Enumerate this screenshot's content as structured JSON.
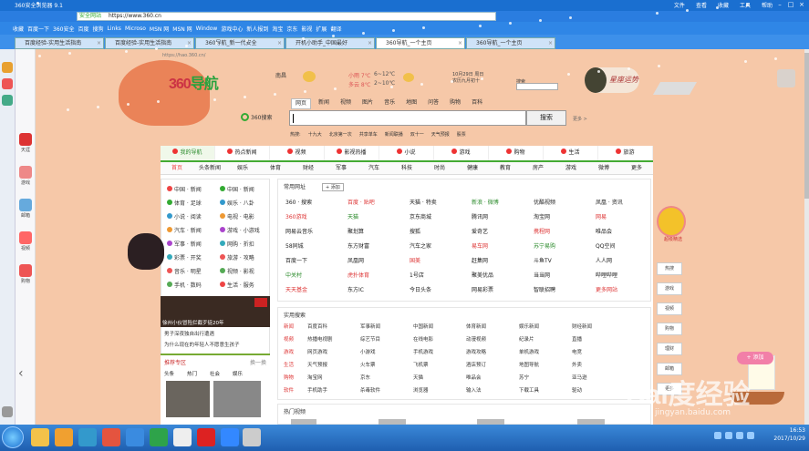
{
  "window": {
    "title": "360安全浏览器 9.1",
    "right_items": [
      "文件",
      "查看",
      "收藏",
      "工具",
      "帮助"
    ],
    "winbtns": [
      "–",
      "□",
      "×"
    ]
  },
  "address": {
    "security": "安全网站",
    "url": "https://www.360.cn"
  },
  "bookmarks": [
    "收藏",
    "百度一下",
    "360安全",
    "百度",
    "搜狗",
    "Links",
    "Microso",
    "MSN 网",
    "MSN 网",
    "Window",
    "游戏中心",
    "新人报到",
    "淘宝",
    "京东",
    "影视",
    "扩展",
    "翻译"
  ],
  "tabs": [
    {
      "label": "百度经验-实用生活指南",
      "active": false
    },
    {
      "label": "百度经验-实用生活指南",
      "active": false
    },
    {
      "label": "360导航_新一代安全",
      "active": false
    },
    {
      "label": "开机小助手_中国最好",
      "active": false
    },
    {
      "label": "360导航_一个主页",
      "active": true
    },
    {
      "label": "360导航_一个主页",
      "active": false
    }
  ],
  "side_labels": [
    "天涯",
    "游戏",
    "邮箱",
    "视频",
    "购物"
  ],
  "page": {
    "url_hint": "https://hao.360.cn/",
    "logo_prefix": "360",
    "logo_text": "导航",
    "weather": {
      "city": "南昌",
      "cond1": "小雨 7℃",
      "cond2": "多云 8℃",
      "day1": "今天",
      "day2": "明天",
      "temp1": "6~12℃",
      "temp2": "2~10℃"
    },
    "date": {
      "line1": "10月29日 周日",
      "line2": "农历九月初十"
    },
    "search_label": "搜索",
    "avatar_text": "星座运势",
    "search_tabs": [
      "网页",
      "新闻",
      "视频",
      "图片",
      "音乐",
      "地图",
      "问答",
      "购物",
      "百科"
    ],
    "search_engine": "360搜索",
    "search_button": "搜索",
    "search_extra": "更多 >",
    "hot_words": [
      "热搜:",
      "十九大",
      "北京第一次",
      "共享单车",
      "新闻联播",
      "双十一",
      "天气预报",
      "股票"
    ],
    "top_nav": [
      {
        "label": "我的导航",
        "active": true
      },
      {
        "label": "热点新闻",
        "active": false
      },
      {
        "label": "视频",
        "active": false
      },
      {
        "label": "影视热播",
        "active": false
      },
      {
        "label": "小说",
        "active": false
      },
      {
        "label": "游戏",
        "active": false
      },
      {
        "label": "购物",
        "active": false
      },
      {
        "label": "生活",
        "active": false
      },
      {
        "label": "旅游",
        "active": false
      }
    ],
    "sub_nav": [
      "首页",
      "头条新闻",
      "娱乐",
      "体育",
      "财经",
      "军事",
      "汽车",
      "科技",
      "时尚",
      "健康",
      "教育",
      "房产",
      "游戏",
      "微博",
      "更多"
    ],
    "left_links": [
      [
        "中国 · 新闻",
        "中国 · 新闻"
      ],
      [
        "体育 · 足球",
        "娱乐 · 八卦"
      ],
      [
        "小说 · 阅读",
        "电视 · 电影"
      ],
      [
        "汽车 · 新闻",
        "游戏 · 小游戏"
      ],
      [
        "军事 · 新闻",
        "网购 · 折扣"
      ],
      [
        "彩票 · 开奖",
        "旅游 · 攻略"
      ],
      [
        "音乐 · 明星",
        "视频 · 影视"
      ],
      [
        "手机 · 数码",
        "生活 · 服务"
      ]
    ],
    "news_caption": "徐州小伙冒险拦截歹徒20年",
    "news_lines": [
      "男子深夜独自出行遭遇",
      "为什么现在的年轻人不愿意生孩子"
    ],
    "rec_title": "推荐专区",
    "rec_more": "换一换",
    "rec_tabs": [
      "头条",
      "热门",
      "社会",
      "娱乐"
    ],
    "grid_title": "常用网址",
    "grid_btn": "+ 添加",
    "grid": [
      [
        "360 · 搜索",
        "百度 · 贴吧",
        "天猫 · 特卖",
        "新浪 · 微博",
        "优酷视频",
        "凤凰 · 资讯"
      ],
      [
        "360游戏",
        "天猫",
        "京东商城",
        "腾讯网",
        "淘宝网",
        "网易"
      ],
      [
        "网易云音乐",
        "聚划算",
        "搜狐",
        "爱奇艺",
        "携程网",
        "唯品会"
      ],
      [
        "58同城",
        "东方财富",
        "汽车之家",
        "易车网",
        "苏宁易购",
        "QQ空间"
      ],
      [
        "百度一下",
        "凤凰网",
        "国美",
        "赶集网",
        "斗鱼TV",
        "人人网"
      ],
      [
        "中关村",
        "虎扑体育",
        "1号店",
        "聚美优品",
        "当当网",
        "哔哩哔哩"
      ],
      [
        "天天基金",
        "东方IC",
        "今日头条",
        "网易彩票",
        "智联招聘",
        "更多网站"
      ]
    ],
    "section2_title": "实用搜索",
    "section2": [
      [
        "新闻",
        "百度百科",
        "军事新闻",
        "中国新闻",
        "体育新闻",
        "娱乐新闻",
        "财经新闻"
      ],
      [
        "视频",
        "热播电视剧",
        "综艺节目",
        "在线电影",
        "动漫视频",
        "纪录片",
        "直播"
      ],
      [
        "游戏",
        "网页游戏",
        "小游戏",
        "手机游戏",
        "游戏攻略",
        "单机游戏",
        "电竞"
      ],
      [
        "生活",
        "天气预报",
        "火车票",
        "飞机票",
        "酒店预订",
        "地图导航",
        "外卖"
      ],
      [
        "购物",
        "淘宝网",
        "京东",
        "天猫",
        "唯品会",
        "苏宁",
        "亚马逊"
      ],
      [
        "软件",
        "手机助手",
        "杀毒软件",
        "浏览器",
        "输入法",
        "下载工具",
        "驱动"
      ]
    ],
    "section3_title": "热门视频",
    "right_rail": [
      "超级精选",
      "热搜",
      "游戏",
      "视频",
      "购物",
      "理财",
      "邮箱",
      "更多"
    ],
    "badge_label": "超级精选",
    "pink_bubble": "+ 添加",
    "watermark": "Bai度经验",
    "watermark_url": "jingyan.baidu.com"
  },
  "tray": {
    "time": "16:53",
    "date": "2017/10/29"
  }
}
